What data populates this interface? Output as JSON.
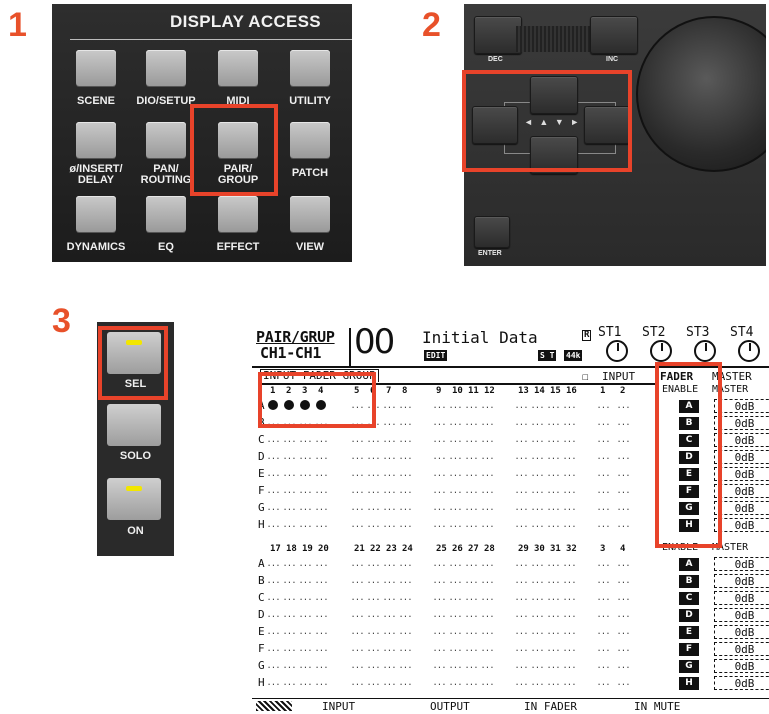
{
  "steps": [
    "1",
    "2",
    "3"
  ],
  "panel1": {
    "title": "DISPLAY ACCESS",
    "buttons": [
      {
        "label": "SCENE"
      },
      {
        "label": "DIO/SETUP"
      },
      {
        "label": "MIDI"
      },
      {
        "label": "UTILITY"
      },
      {
        "label": "ø/INSERT/\nDELAY"
      },
      {
        "label": "PAN/\nROUTING"
      },
      {
        "label": "PAIR/\nGROUP"
      },
      {
        "label": "PATCH"
      },
      {
        "label": "DYNAMICS"
      },
      {
        "label": "EQ"
      },
      {
        "label": "EFFECT"
      },
      {
        "label": "VIEW"
      }
    ]
  },
  "panel2": {
    "dec": "DEC",
    "inc": "INC",
    "enter": "ENTER",
    "arrows": "◄ ▲ ▼ ►"
  },
  "panel3": {
    "sel": "SEL",
    "solo": "SOLO",
    "on": "ON",
    "led_color": "#f2e600"
  },
  "lcd": {
    "page": "PAIR/GRUP",
    "channel": "CH1-CH1",
    "scene_number": "00",
    "scene_name": "Initial Data",
    "edit": "EDIT",
    "st": "S T",
    "rate": "44k",
    "r": "R",
    "st_labels": [
      "ST1",
      "ST2",
      "ST3",
      "ST4"
    ],
    "section": "INPUT FADER GROUP",
    "input_label": "INPUT",
    "fader_label": "FADER",
    "master_label": "MASTER",
    "enable_label": "ENABLE",
    "top_nums": [
      "1",
      "2",
      "3",
      "4",
      "5",
      "6",
      "7",
      "8",
      "9",
      "10",
      "11",
      "12",
      "13",
      "14",
      "15",
      "16",
      "1",
      "2"
    ],
    "bottom_nums": [
      "17",
      "18",
      "19",
      "20",
      "21",
      "22",
      "23",
      "24",
      "25",
      "26",
      "27",
      "28",
      "29",
      "30",
      "31",
      "32",
      "3",
      "4"
    ],
    "groups": [
      "A",
      "B",
      "C",
      "D",
      "E",
      "F",
      "G",
      "H"
    ],
    "active_dots": 4,
    "cell_placeholder": "...",
    "master_value": "0dB",
    "tabs": [
      "INPUT",
      "OUTPUT",
      "IN FADER",
      "IN MUTE"
    ]
  },
  "colors": {
    "highlight": "#e8432a",
    "step": "#e8512a"
  }
}
